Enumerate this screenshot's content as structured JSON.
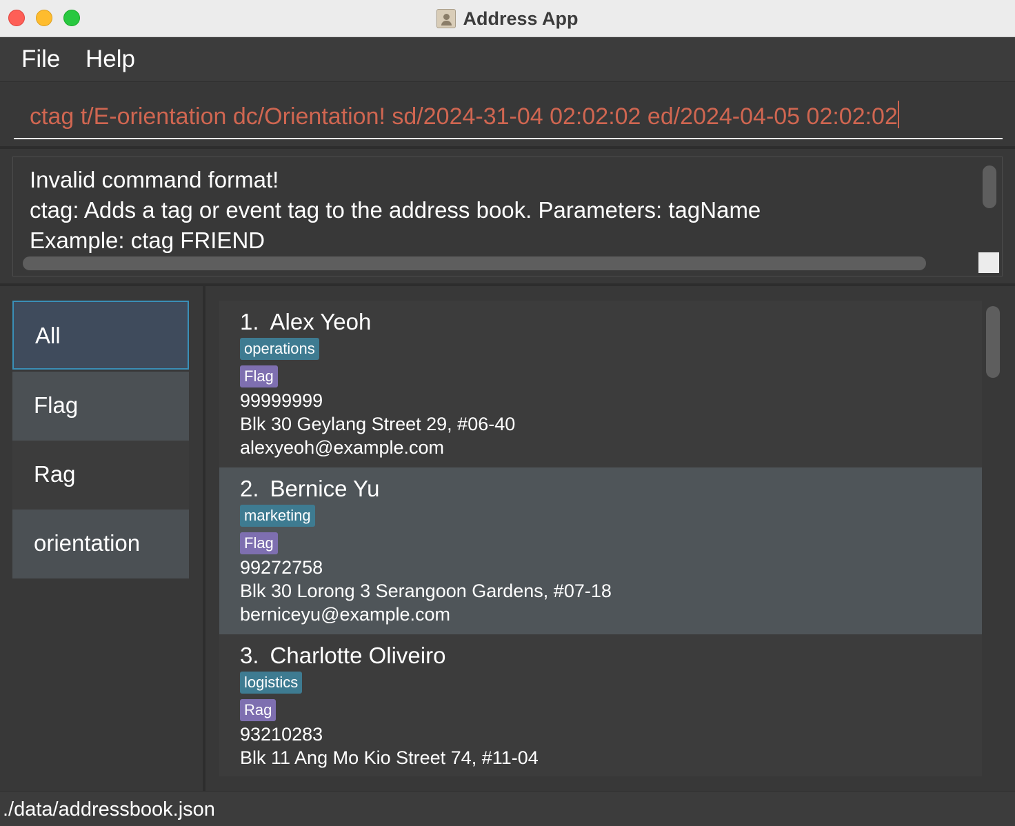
{
  "window": {
    "title": "Address App"
  },
  "menu": {
    "file": "File",
    "help": "Help"
  },
  "command": {
    "value": "ctag t/E-orientation dc/Orientation! sd/2024-31-04 02:02:02 ed/2024-04-05 02:02:02"
  },
  "result": {
    "lines": [
      "Invalid command format!",
      "ctag: Adds a tag or event tag to the address book. Parameters: tagName",
      "Example: ctag FRIEND"
    ]
  },
  "sidebar": {
    "items": [
      {
        "label": "All",
        "selected": true
      },
      {
        "label": "Flag"
      },
      {
        "label": "Rag"
      },
      {
        "label": "orientation"
      }
    ]
  },
  "persons": [
    {
      "index": "1.",
      "name": "Alex Yeoh",
      "tags": [
        "operations",
        "Flag"
      ],
      "phone": "99999999",
      "address": "Blk 30 Geylang Street 29, #06-40",
      "email": "alexyeoh@example.com"
    },
    {
      "index": "2.",
      "name": "Bernice Yu",
      "tags": [
        "marketing",
        "Flag"
      ],
      "phone": "99272758",
      "address": "Blk 30 Lorong 3 Serangoon Gardens, #07-18",
      "email": "berniceyu@example.com"
    },
    {
      "index": "3.",
      "name": "Charlotte Oliveiro",
      "tags": [
        "logistics",
        "Rag"
      ],
      "phone": "93210283",
      "address": "Blk 11 Ang Mo Kio Street 74, #11-04",
      "email": ""
    }
  ],
  "status": {
    "path": "./data/addressbook.json"
  },
  "colors": {
    "background": "#383838",
    "command_text": "#d06651",
    "role_tag": "#3e7b91",
    "mark_tag": "#7e6fb0",
    "selected_item": "#3f4b5c",
    "selected_border": "#3a8fb7",
    "alt_card": "#4f5559"
  }
}
